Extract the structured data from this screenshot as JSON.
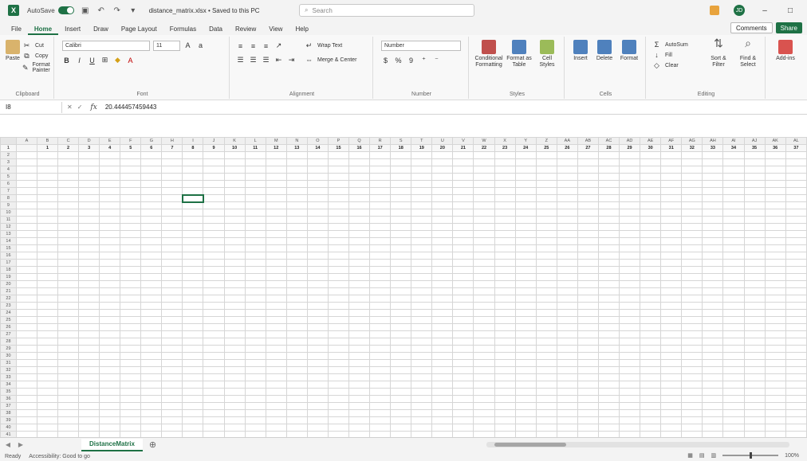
{
  "titlebar": {
    "autosave_label": "AutoSave",
    "autosave_state": "On",
    "doc_title": "distance_matrix.xlsx • Saved to this PC",
    "search_placeholder": "Search",
    "avatar_initials": "JD"
  },
  "tabs": [
    "File",
    "Home",
    "Insert",
    "Draw",
    "Page Layout",
    "Formulas",
    "Data",
    "Review",
    "View",
    "Help"
  ],
  "active_tab": "Home",
  "comments_label": "Comments",
  "share_label": "Share",
  "ribbon": {
    "clipboard": {
      "paste": "Paste",
      "cut": "Cut",
      "copy": "Copy",
      "format_painter": "Format Painter",
      "label": "Clipboard"
    },
    "font": {
      "name": "Calibri",
      "size": "11",
      "label": "Font"
    },
    "alignment": {
      "wrap": "Wrap Text",
      "merge": "Merge & Center",
      "label": "Alignment"
    },
    "number": {
      "format": "Number",
      "label": "Number"
    },
    "styles": {
      "conditional": "Conditional Formatting",
      "table": "Format as Table",
      "cell": "Cell Styles",
      "label": "Styles"
    },
    "cells": {
      "insert": "Insert",
      "delete": "Delete",
      "format": "Format",
      "label": "Cells"
    },
    "editing": {
      "autosum": "AutoSum",
      "fill": "Fill",
      "clear": "Clear",
      "sort": "Sort & Filter",
      "find": "Find & Select",
      "label": "Editing"
    },
    "addins": {
      "label": "Add-ins"
    }
  },
  "formula_bar": {
    "name_box": "I8",
    "value": "20.444457459443"
  },
  "grid": {
    "columns": [
      "A",
      "B",
      "C",
      "D",
      "E",
      "F",
      "G",
      "H",
      "I",
      "J",
      "K",
      "L",
      "M",
      "N",
      "O",
      "P",
      "Q",
      "R",
      "S",
      "T",
      "U",
      "V",
      "W",
      "X",
      "Y",
      "Z",
      "AA",
      "AB",
      "AC",
      "AD",
      "AE",
      "AF",
      "AG",
      "AH",
      "AI",
      "AJ",
      "AK",
      "AL"
    ],
    "header_row": [
      "",
      "1",
      "2",
      "3",
      "4",
      "5",
      "6",
      "7",
      "8",
      "9",
      "10",
      "11",
      "12",
      "13",
      "14",
      "15",
      "16",
      "17",
      "18",
      "19",
      "20",
      "21",
      "22",
      "23",
      "24",
      "25",
      "26",
      "27",
      "28",
      "29",
      "30",
      "31",
      "32",
      "33",
      "34",
      "35",
      "36",
      "37"
    ],
    "row_start": 1,
    "row_count": 41,
    "selected_cell": "I8"
  },
  "sheet_tab": "DistanceMatrix",
  "status": {
    "ready": "Ready",
    "accessibility": "Accessibility: Good to go",
    "zoom": "100%"
  }
}
